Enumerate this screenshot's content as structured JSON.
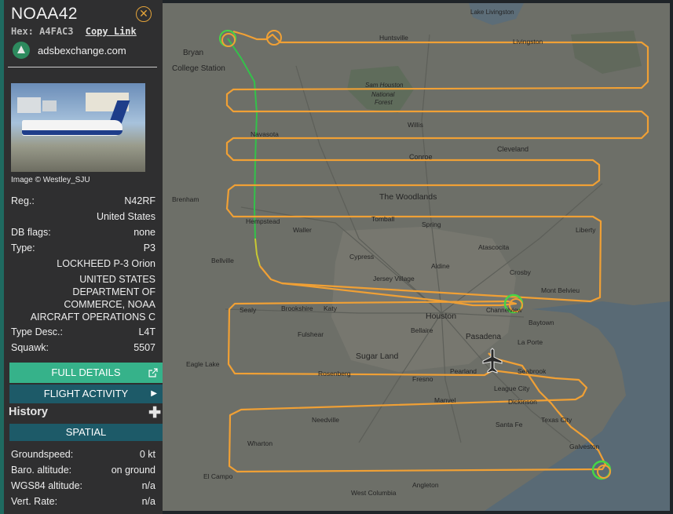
{
  "aircraft": {
    "callsign": "NOAA42",
    "hex_label": "Hex:",
    "hex": "A4FAC3",
    "copy_link": "Copy Link",
    "site": "adsbexchange.com",
    "photo_credit": "Image © Westley_SJU"
  },
  "details": {
    "reg_label": "Reg.:",
    "reg": "N42RF",
    "country": "United States",
    "dbflags_label": "DB flags:",
    "dbflags": "none",
    "type_label": "Type:",
    "type": "P3",
    "model": "LOCKHEED P-3 Orion",
    "operator_lines": [
      "UNITED STATES",
      "DEPARTMENT OF",
      "COMMERCE, NOAA",
      "AIRCRAFT OPERATIONS C"
    ],
    "typedesc_label": "Type Desc.:",
    "typedesc": "L4T",
    "squawk_label": "Squawk:",
    "squawk": "5507"
  },
  "buttons": {
    "full_details": "FULL DETAILS",
    "flight_activity": "FLIGHT ACTIVITY",
    "history": "History",
    "spatial": "SPATIAL"
  },
  "spatial": {
    "groundspeed_label": "Groundspeed:",
    "groundspeed": "0 kt",
    "baro_label": "Baro. altitude:",
    "baro": "on ground",
    "wgs_label": "WGS84 altitude:",
    "wgs": "n/a",
    "vrate_label": "Vert. Rate:",
    "vrate": "n/a"
  },
  "map": {
    "colors": {
      "track_main": "#f0a035",
      "track_climb": "#33c24a",
      "track_yellow": "#c8c833",
      "marker_green": "#46d646",
      "land": "#6d6f68",
      "water": "#596a75"
    },
    "places": {
      "lake_livingston": "Lake Livingston",
      "bryan": "Bryan",
      "college_station": "College Station",
      "huntsville": "Huntsville",
      "livingston": "Livingston",
      "sam_houston": "Sam Houston",
      "national": "National",
      "forest": "Forest",
      "willis": "Willis",
      "navasota": "Navasota",
      "conroe": "Conroe",
      "cleveland": "Cleveland",
      "the_woodlands": "The Woodlands",
      "brenham": "Brenham",
      "tomball": "Tomball",
      "hempstead": "Hempstead",
      "waller": "Waller",
      "spring": "Spring",
      "liberty": "Liberty",
      "atascocita": "Atascocita",
      "cypress": "Cypress",
      "bellville": "Bellville",
      "aldine": "Aldine",
      "jersey_village": "Jersey Village",
      "crosby": "Crosby",
      "mont_belvieu": "Mont Belvieu",
      "sealy": "Sealy",
      "brookshire": "Brookshire",
      "katy": "Katy",
      "houston": "Houston",
      "channelview": "Channelview",
      "baytown": "Baytown",
      "fulshear": "Fulshear",
      "bellaire": "Bellaire",
      "pasadena": "Pasadena",
      "la_porte": "La Porte",
      "sugar_land": "Sugar Land",
      "eagle_lake": "Eagle Lake",
      "rosenberg": "Rosenberg",
      "pearland": "Pearland",
      "seabrook": "Seabrook",
      "fresno": "Fresno",
      "league_city": "League City",
      "manvel": "Manvel",
      "dickinson": "Dickinson",
      "needville": "Needville",
      "santa_fe": "Santa Fe",
      "texas_city": "Texas City",
      "wharton": "Wharton",
      "galveston": "Galveston",
      "el_campo": "El Campo",
      "angleton": "Angleton",
      "west_columbia": "West Columbia"
    }
  }
}
